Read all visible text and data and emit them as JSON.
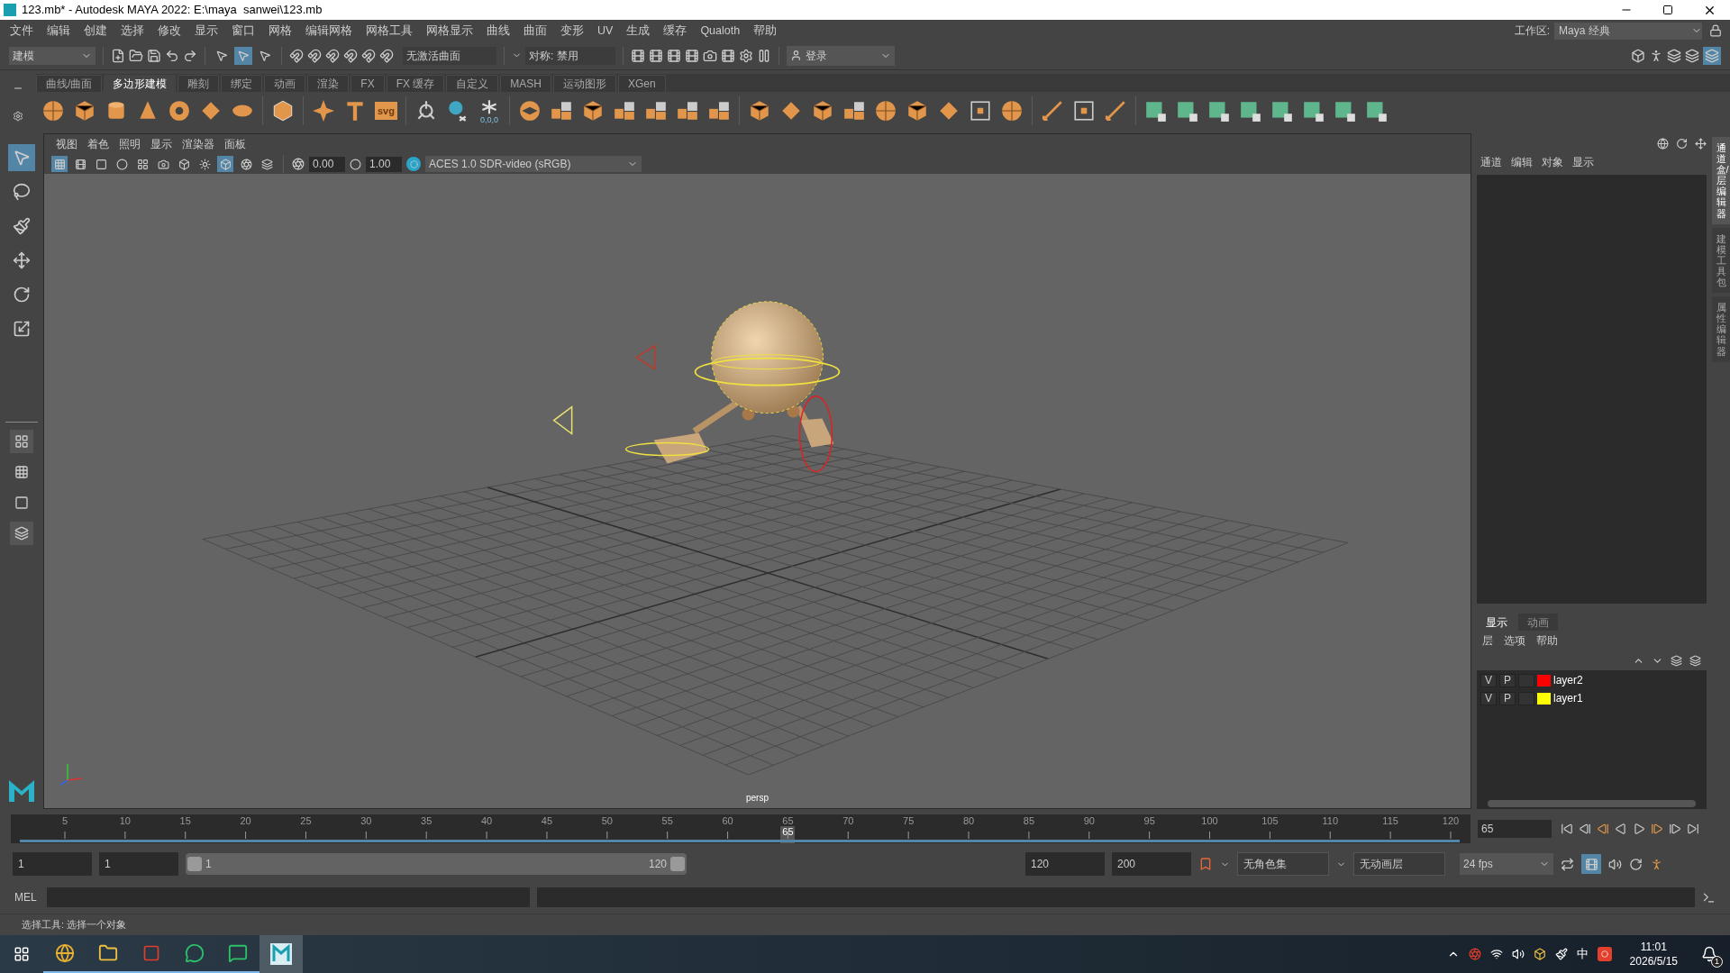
{
  "window": {
    "title": "123.mb* - Autodesk MAYA 2022: E:\\maya  sanwei\\123.mb"
  },
  "menu_bar": [
    "文件",
    "编辑",
    "创建",
    "选择",
    "修改",
    "显示",
    "窗口",
    "网格",
    "编辑网格",
    "网格工具",
    "网格显示",
    "曲线",
    "曲面",
    "变形",
    "UV",
    "生成",
    "缓存",
    "Qualoth",
    "帮助"
  ],
  "status_line": {
    "menu_set": "建模",
    "select_modes": [
      {
        "selected": false
      },
      {
        "selected": true
      },
      {
        "selected": false
      }
    ],
    "curve_field": "无激活曲面",
    "symmetry_field": "对称: 禁用",
    "login": "登录",
    "workspace_label": "工作区:",
    "workspace": "Maya 经典"
  },
  "shelf": {
    "tabs": [
      {
        "label": "曲线/曲面",
        "selected": false
      },
      {
        "label": "多边形建模",
        "selected": true
      },
      {
        "label": "雕刻",
        "selected": false
      },
      {
        "label": "绑定",
        "selected": false
      },
      {
        "label": "动画",
        "selected": false
      },
      {
        "label": "渲染",
        "selected": false
      },
      {
        "label": "FX",
        "selected": false
      },
      {
        "label": "FX 缓存",
        "selected": false
      },
      {
        "label": "自定义",
        "selected": false
      },
      {
        "label": "MASH",
        "selected": false
      },
      {
        "label": "运动图形",
        "selected": false
      },
      {
        "label": "XGen",
        "selected": false
      }
    ],
    "svg_label": "svg",
    "snowflake_label": "0,0,0"
  },
  "tools": [
    {
      "selected": true
    },
    {
      "selected": false
    },
    {
      "selected": false
    },
    {
      "selected": false
    },
    {
      "selected": false
    },
    {
      "selected": false
    }
  ],
  "viewport": {
    "menu": [
      "视图",
      "着色",
      "照明",
      "显示",
      "渲染器",
      "面板"
    ],
    "toggles": [
      {
        "on": true
      },
      {
        "on": false
      },
      {
        "on": false
      },
      {
        "on": false
      },
      {
        "on": false
      },
      {
        "on": false
      },
      {
        "on": false
      },
      {
        "on": false
      },
      {
        "on": true
      },
      {
        "on": false
      },
      {
        "on": false
      }
    ],
    "exposure": "0.00",
    "gamma": "1.00",
    "color_space": "ACES 1.0 SDR-video (sRGB)",
    "camera_label": "persp"
  },
  "channel_box": {
    "menu": [
      "通道",
      "编辑",
      "对象",
      "显示"
    ]
  },
  "side_tabs": [
    {
      "label": "通道盒/层编辑器",
      "selected": true
    },
    {
      "label": "建模工具包",
      "selected": false
    },
    {
      "label": "属性编辑器",
      "selected": false
    }
  ],
  "layer_editor": {
    "tabs": [
      {
        "label": "显示",
        "selected": true
      },
      {
        "label": "动画",
        "selected": false
      }
    ],
    "menu": [
      "层",
      "选项",
      "帮助"
    ],
    "layers": [
      {
        "visible": "V",
        "playback": "P",
        "color": "#ff0000",
        "name": "layer2"
      },
      {
        "visible": "V",
        "playback": "P",
        "color": "#ffff00",
        "name": "layer1"
      }
    ]
  },
  "timeline": {
    "ticks": [
      "5",
      "10",
      "15",
      "20",
      "25",
      "30",
      "35",
      "40",
      "45",
      "50",
      "55",
      "60",
      "65",
      "70",
      "75",
      "80",
      "85",
      "90",
      "95",
      "100",
      "105",
      "110",
      "115",
      "120"
    ],
    "current_frame": "65",
    "frame_field": "65"
  },
  "range": {
    "slider": {
      "level": 1
    },
    "start": "1",
    "playback_start": "1",
    "range_start": "1",
    "range_end": "120",
    "playback_end": "120",
    "end": "200",
    "character_set": "无角色集",
    "anim_layer": "无动画层",
    "fps": "24 fps",
    "autokey_on": true
  },
  "command_line": {
    "language": "MEL"
  },
  "help_line": "选择工具: 选择一个对象",
  "taskbar": {
    "ime": "中",
    "time": "11:01",
    "date": "2026/5/15",
    "notification_count": "1"
  }
}
